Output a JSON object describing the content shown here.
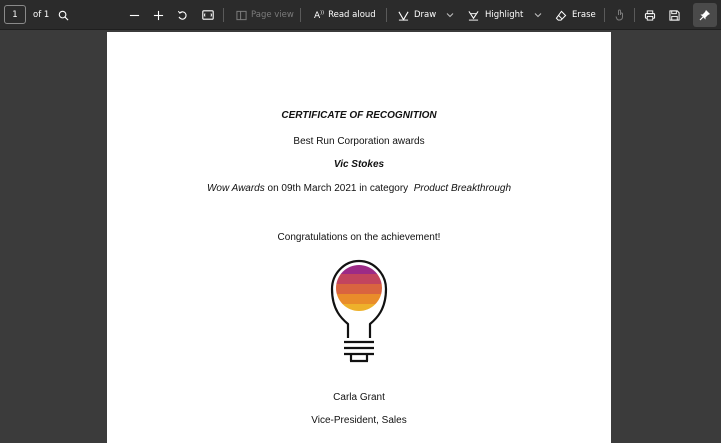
{
  "toolbar": {
    "page_number": "1",
    "page_count": "of 1",
    "page_view_label": "Page view",
    "read_aloud_label": "Read aloud",
    "draw_label": "Draw",
    "highlight_label": "Highlight",
    "erase_label": "Erase",
    "icons": [
      "search-icon",
      "zoom-out-icon",
      "zoom-in-icon",
      "rotate-icon",
      "fit-page-icon",
      "page-view-icon",
      "read-aloud-icon",
      "draw-icon",
      "chevron-down-icon",
      "highlight-icon",
      "erase-icon",
      "touch-icon",
      "print-icon",
      "save-icon",
      "pin-icon"
    ]
  },
  "document": {
    "title": "CERTIFICATE OF RECOGNITION",
    "issuer_line": "Best Run Corporation awards",
    "recipient": "Vic Stokes",
    "award_name": "Wow Awards",
    "award_middle": "on 09th March 2021 in category",
    "category": "Product Breakthrough",
    "congrats": "Congratulations on the achievement!",
    "signer_name": "Carla Grant",
    "signer_title": "Vice-President, Sales"
  },
  "colors": {
    "toolbar_bg": "#2b2b2b",
    "canvas_bg": "#3b3b3b",
    "page_bg": "#ffffff",
    "bulb_stripes": [
      "#9c2a86",
      "#c2445e",
      "#d9643f",
      "#e98c2a",
      "#eeb12b"
    ]
  }
}
